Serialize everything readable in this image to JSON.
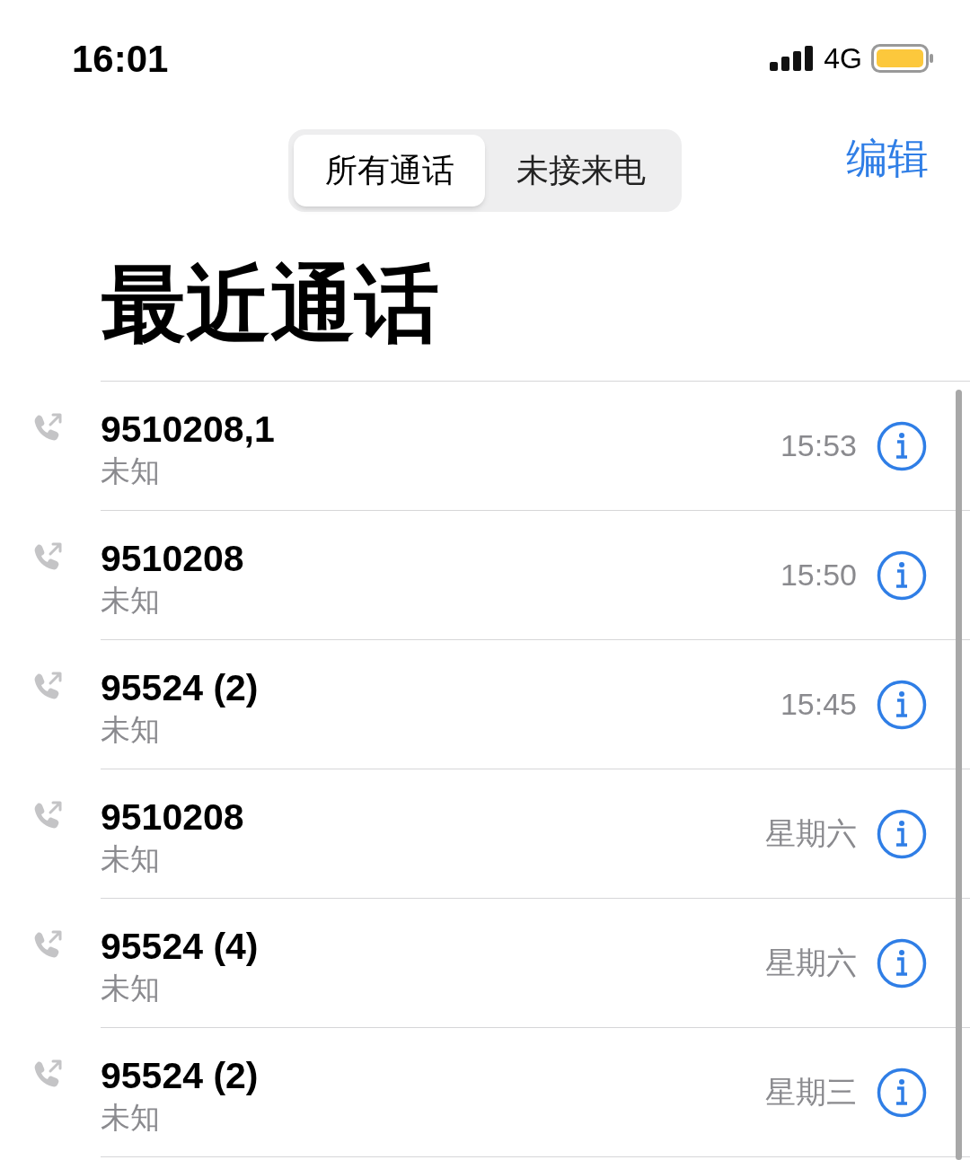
{
  "status_bar": {
    "time": "16:01",
    "network": "4G"
  },
  "segments": [
    {
      "label": "所有通话",
      "selected": true
    },
    {
      "label": "未接来电",
      "selected": false
    }
  ],
  "edit_button": "编辑",
  "title": "最近通话",
  "calls": [
    {
      "number": "9510208,1",
      "label": "未知",
      "time": "15:53"
    },
    {
      "number": "9510208",
      "label": "未知",
      "time": "15:50"
    },
    {
      "number": "95524 (2)",
      "label": "未知",
      "time": "15:45"
    },
    {
      "number": "9510208",
      "label": "未知",
      "time": "星期六"
    },
    {
      "number": "95524 (4)",
      "label": "未知",
      "time": "星期六"
    },
    {
      "number": "95524 (2)",
      "label": "未知",
      "time": "星期三"
    }
  ]
}
